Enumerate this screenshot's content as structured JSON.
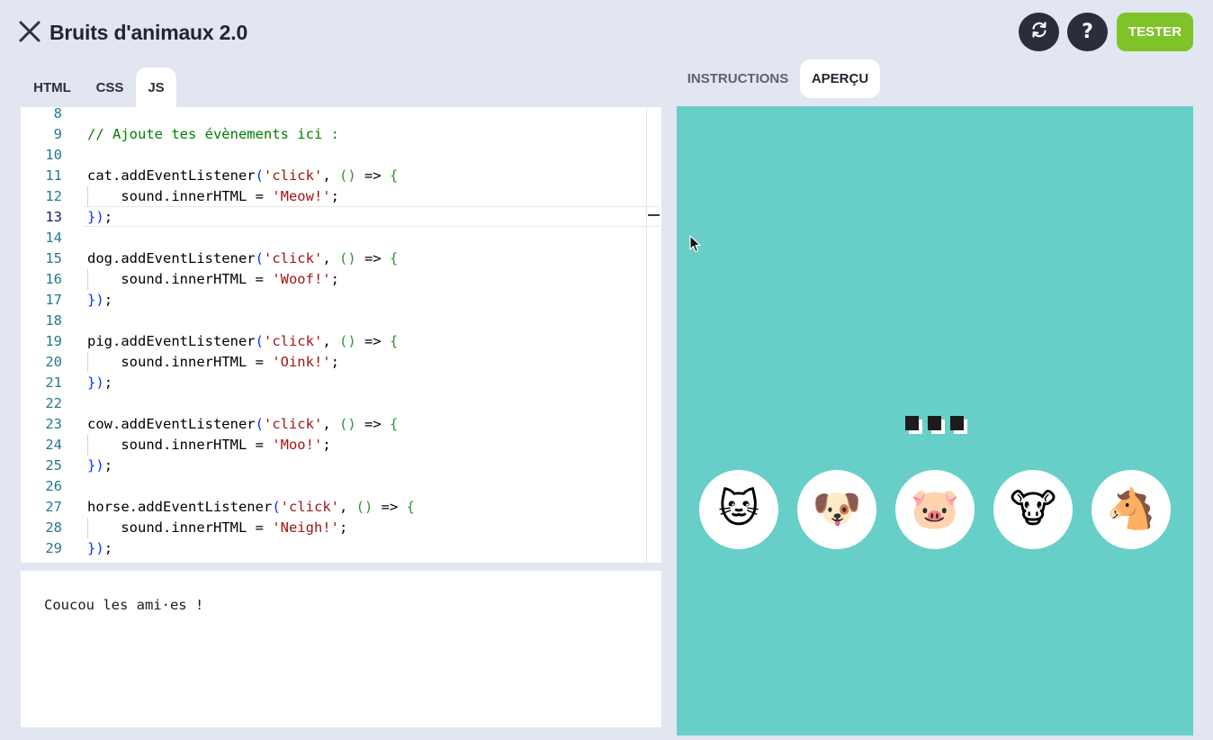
{
  "header": {
    "title": "Bruits d'animaux 2.0",
    "help_label": "?",
    "test_label": "TESTER"
  },
  "left_tabs": [
    {
      "label": "HTML",
      "active": false
    },
    {
      "label": "CSS",
      "active": false
    },
    {
      "label": "JS",
      "active": true
    }
  ],
  "right_tabs": [
    {
      "label": "INSTRUCTIONS",
      "active": false
    },
    {
      "label": "APERÇU",
      "active": true
    }
  ],
  "editor": {
    "active_line": 13,
    "lines": [
      {
        "n": "8",
        "code": ""
      },
      {
        "n": "9",
        "code": "// Ajoute tes évènements ici :"
      },
      {
        "n": "10",
        "code": ""
      },
      {
        "n": "11",
        "code": "cat.addEventListener('click', () => {"
      },
      {
        "n": "12",
        "code": "    sound.innerHTML = 'Meow!';"
      },
      {
        "n": "13",
        "code": "});"
      },
      {
        "n": "14",
        "code": ""
      },
      {
        "n": "15",
        "code": "dog.addEventListener('click', () => {"
      },
      {
        "n": "16",
        "code": "    sound.innerHTML = 'Woof!';"
      },
      {
        "n": "17",
        "code": "});"
      },
      {
        "n": "18",
        "code": ""
      },
      {
        "n": "19",
        "code": "pig.addEventListener('click', () => {"
      },
      {
        "n": "20",
        "code": "    sound.innerHTML = 'Oink!';"
      },
      {
        "n": "21",
        "code": "});"
      },
      {
        "n": "22",
        "code": ""
      },
      {
        "n": "23",
        "code": "cow.addEventListener('click', () => {"
      },
      {
        "n": "24",
        "code": "    sound.innerHTML = 'Moo!';"
      },
      {
        "n": "25",
        "code": "});"
      },
      {
        "n": "26",
        "code": ""
      },
      {
        "n": "27",
        "code": "horse.addEventListener('click', () => {"
      },
      {
        "n": "28",
        "code": "    sound.innerHTML = 'Neigh!';"
      },
      {
        "n": "29",
        "code": "});"
      }
    ]
  },
  "console": {
    "output": "Coucou les ami·es !"
  },
  "preview": {
    "background": "#67cfc8",
    "sound_display": "■■■",
    "animals": [
      {
        "name": "cat",
        "emoji": "🐱"
      },
      {
        "name": "dog",
        "emoji": "🐶"
      },
      {
        "name": "pig",
        "emoji": "🐷"
      },
      {
        "name": "cow",
        "emoji": "🐮"
      },
      {
        "name": "horse",
        "emoji": "🐴"
      }
    ]
  },
  "colors": {
    "accent_green": "#7ec327",
    "dark_button": "#2a2e3c",
    "page_bg": "#e1e6f0"
  }
}
